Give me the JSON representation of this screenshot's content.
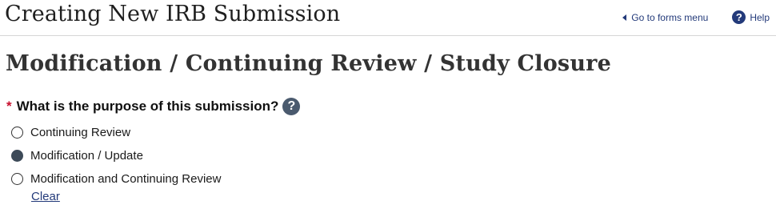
{
  "header": {
    "title": "Creating New IRB Submission",
    "forms_menu_label": "Go to forms menu",
    "forms_menu_icon": "caret-left-icon",
    "help_label": "Help",
    "help_icon": "question-circle-icon"
  },
  "section": {
    "title": "Modification / Continuing Review / Study Closure"
  },
  "question": {
    "required_marker": "*",
    "label": "What is the purpose of this submission?",
    "help_icon": "question-circle-icon",
    "options": [
      {
        "label": "Continuing Review",
        "selected": false
      },
      {
        "label": "Modification / Update",
        "selected": true
      },
      {
        "label": "Modification and Continuing Review",
        "selected": false
      }
    ],
    "clear_label": "Clear"
  },
  "colors": {
    "link": "#233a7a",
    "required": "#c8102e",
    "radio_selected": "#3d4a58"
  }
}
